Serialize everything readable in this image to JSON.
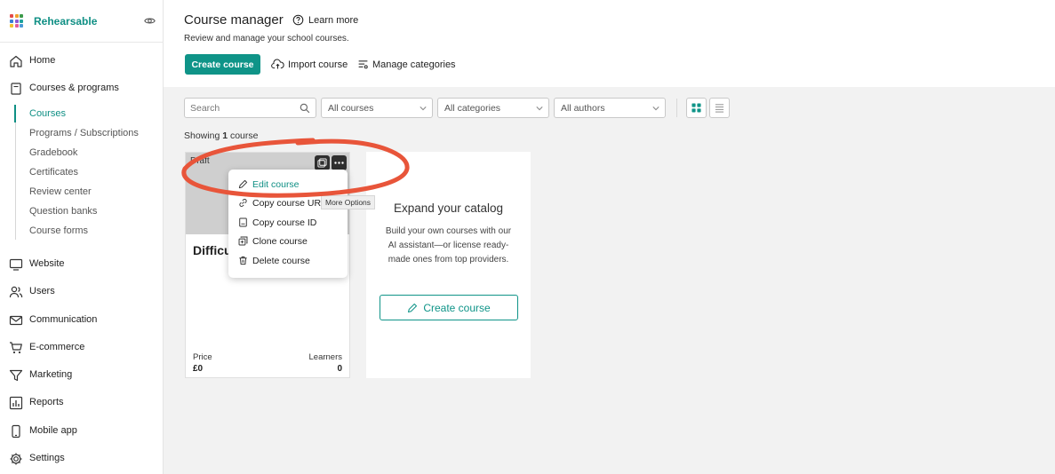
{
  "brand": {
    "name": "Rehearsable"
  },
  "sidebar": {
    "items": [
      {
        "label": "Home",
        "icon": "home-icon"
      },
      {
        "label": "Courses & programs",
        "icon": "book-icon"
      },
      {
        "label": "Website",
        "icon": "monitor-icon"
      },
      {
        "label": "Users",
        "icon": "users-icon"
      },
      {
        "label": "Communication",
        "icon": "mail-icon"
      },
      {
        "label": "E-commerce",
        "icon": "cart-icon"
      },
      {
        "label": "Marketing",
        "icon": "funnel-icon"
      },
      {
        "label": "Reports",
        "icon": "chart-icon"
      },
      {
        "label": "Mobile app",
        "icon": "phone-icon"
      },
      {
        "label": "Settings",
        "icon": "gear-icon"
      }
    ],
    "sub_items": [
      {
        "label": "Courses",
        "active": true
      },
      {
        "label": "Programs / Subscriptions"
      },
      {
        "label": "Gradebook"
      },
      {
        "label": "Certificates"
      },
      {
        "label": "Review center"
      },
      {
        "label": "Question banks"
      },
      {
        "label": "Course forms"
      }
    ]
  },
  "header": {
    "title": "Course manager",
    "learn_more": "Learn more",
    "subtitle": "Review and manage your school courses.",
    "create_course": "Create course",
    "import_course": "Import course",
    "manage_categories": "Manage categories"
  },
  "filters": {
    "search_placeholder": "Search",
    "courses": "All courses",
    "categories": "All categories",
    "authors": "All authors"
  },
  "showing": {
    "prefix": "Showing ",
    "count": "1",
    "suffix": " course"
  },
  "course_card": {
    "thumb_label": "Draft",
    "title": "Difficult Conversations",
    "price_label": "Price",
    "price_value": "£0",
    "learners_label": "Learners",
    "learners_value": "0"
  },
  "dropdown": {
    "items": [
      {
        "label": "Edit course",
        "icon": "pencil-icon",
        "active": true
      },
      {
        "label": "Copy course URL",
        "icon": "link-icon"
      },
      {
        "label": "Copy course ID",
        "icon": "id-icon"
      },
      {
        "label": "Clone course",
        "icon": "clone-icon"
      },
      {
        "label": "Delete course",
        "icon": "trash-icon"
      }
    ],
    "tooltip": "More Options"
  },
  "expand_card": {
    "title": "Expand your catalog",
    "description": "Build your own courses with our AI assistant—or license ready-made ones from top providers.",
    "button": "Create course"
  },
  "colors": {
    "accent": "#0f9488",
    "annotation": "#e8553a"
  }
}
